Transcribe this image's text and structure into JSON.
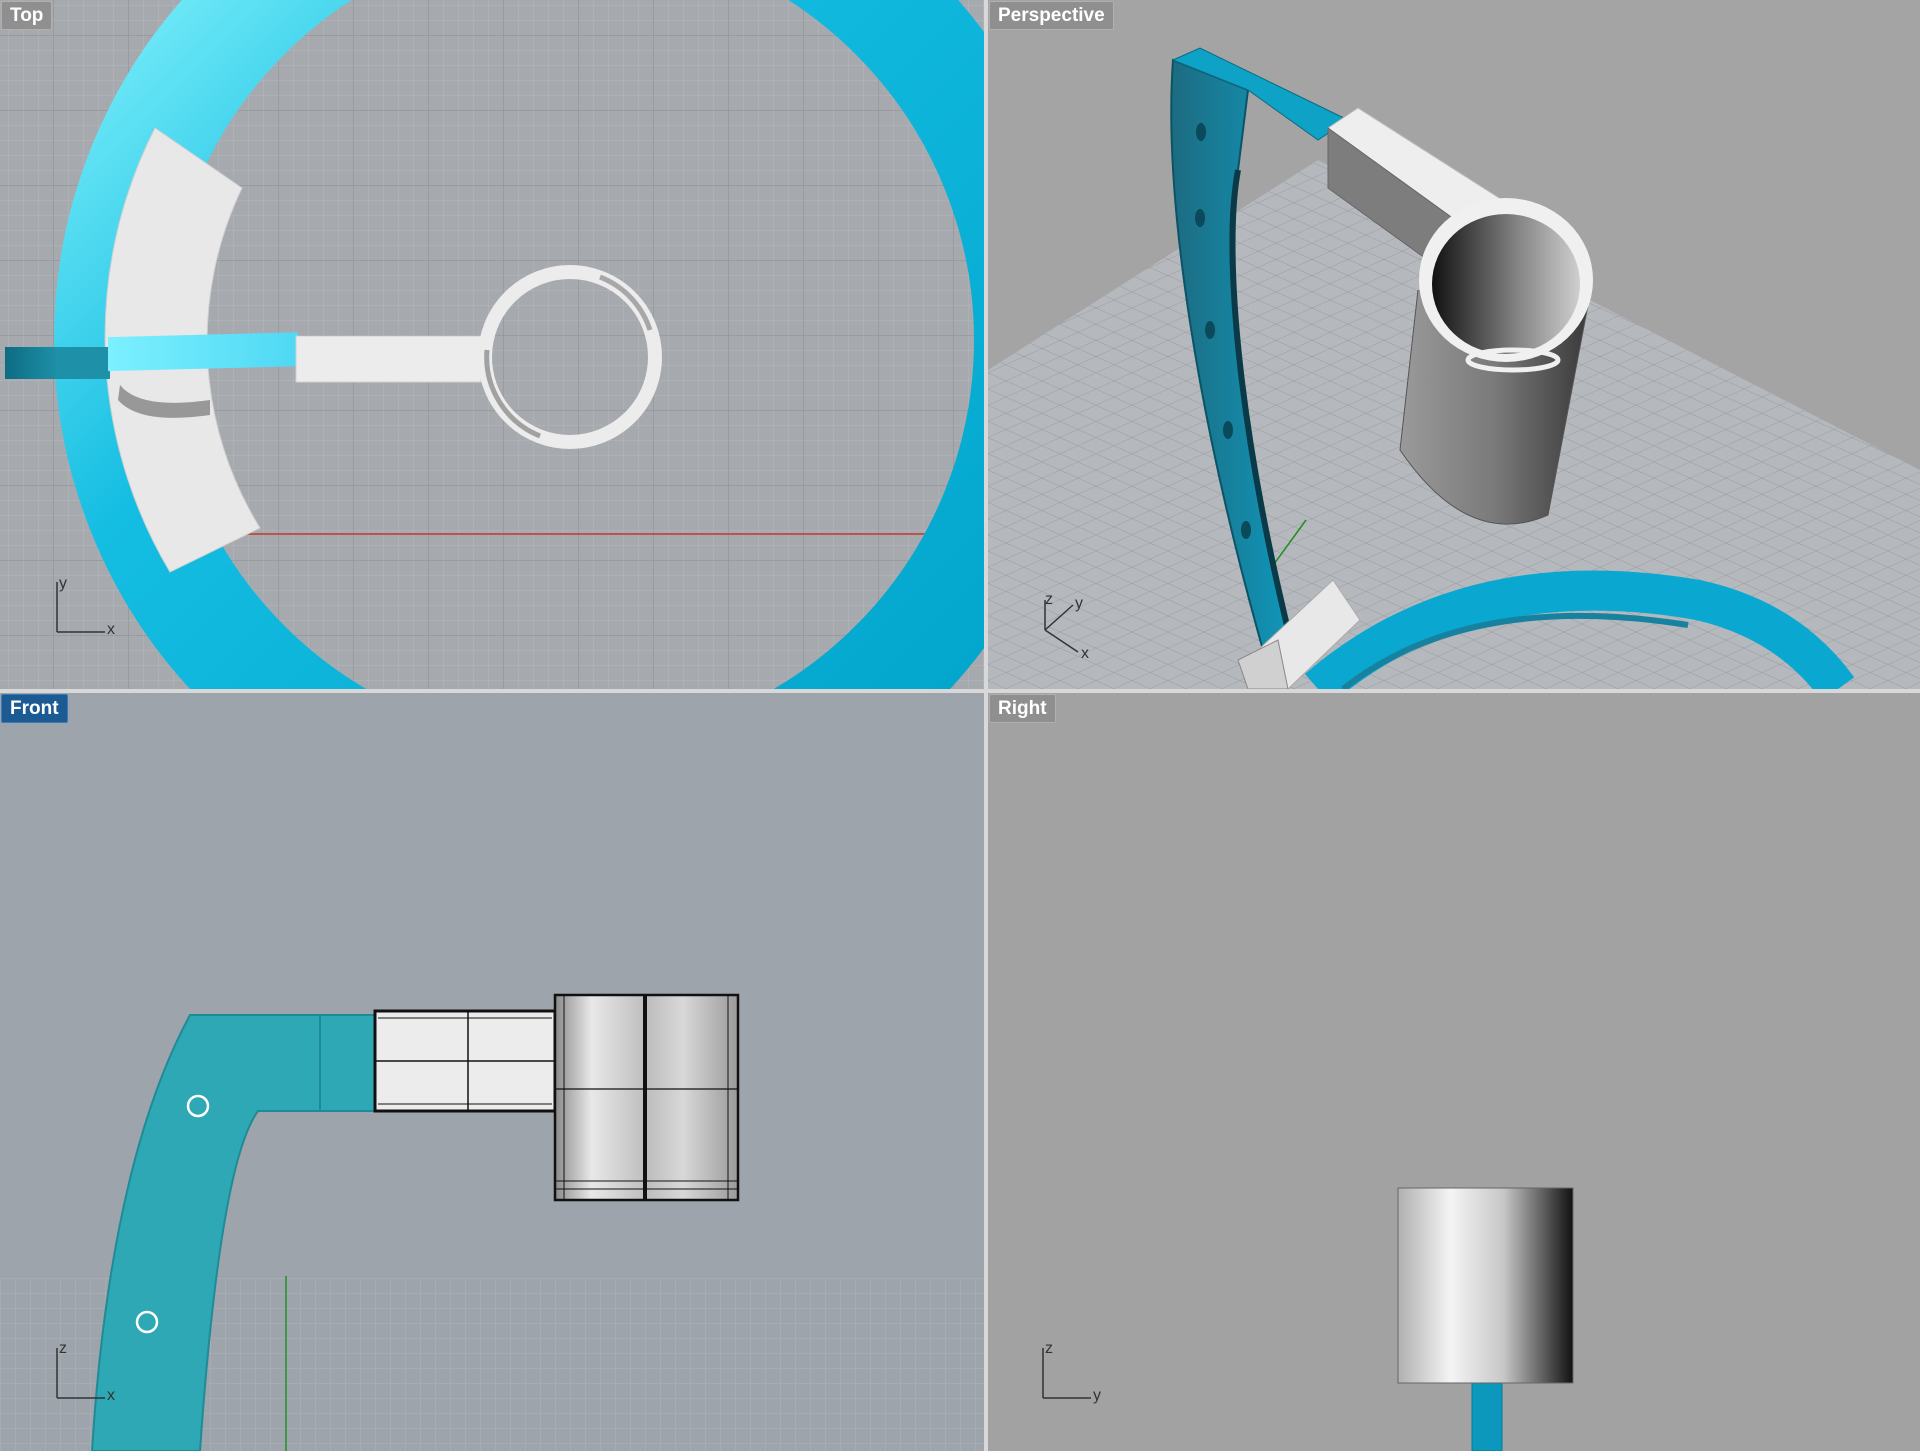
{
  "viewports": {
    "top": {
      "label": "Top",
      "active": false,
      "axes": {
        "vertical": "y",
        "horizontal": "x"
      }
    },
    "perspective": {
      "label": "Perspective",
      "active": false,
      "axes": {
        "vertical": "z",
        "diagonal": "y",
        "horizontal": "x"
      }
    },
    "front": {
      "label": "Front",
      "active": true,
      "axes": {
        "vertical": "z",
        "horizontal": "x"
      }
    },
    "right": {
      "label": "Right",
      "active": false,
      "axes": {
        "vertical": "z",
        "horizontal": "y"
      }
    }
  },
  "colors": {
    "accent_active_label": "#1c5a93",
    "ring_blue": "#00a7d0",
    "arm_teal": "#2ea8b4",
    "part_white": "#e8e8e8",
    "grid_bg_top": "#a6aaae",
    "grid_bg_front": "#9ea4ab",
    "x_axis_red": "#c0392b",
    "y_axis_green": "#1f8f1f"
  }
}
